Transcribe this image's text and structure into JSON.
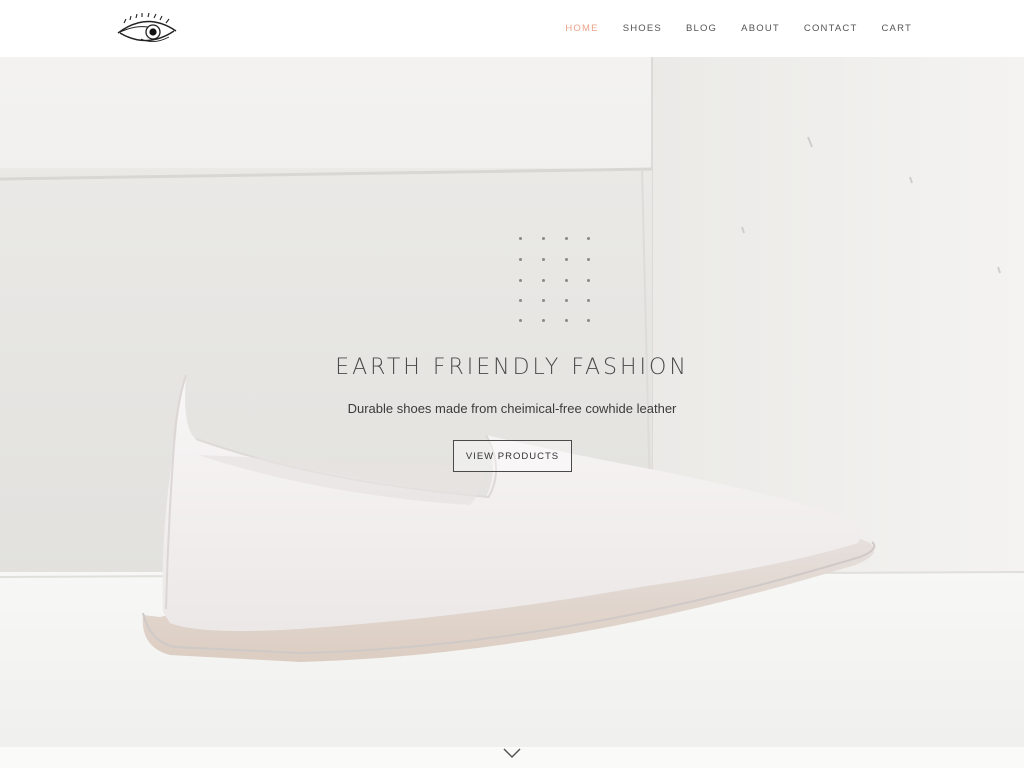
{
  "nav": {
    "items": [
      {
        "label": "HOME",
        "active": true
      },
      {
        "label": "SHOES",
        "active": false
      },
      {
        "label": "BLOG",
        "active": false
      },
      {
        "label": "ABOUT",
        "active": false
      },
      {
        "label": "CONTACT",
        "active": false
      },
      {
        "label": "CART",
        "active": false
      }
    ]
  },
  "hero": {
    "title": "EARTH FRIENDLY FASHION",
    "subtitle": "Durable shoes made from cheimical-free cowhide leather",
    "button_label": "VIEW PRODUCTS"
  },
  "icons": {
    "logo": "eye-logo-icon",
    "scroll": "chevron-down-icon"
  },
  "colors": {
    "active_nav": "#e8a48a",
    "text": "#4a4a4a",
    "background": "#f0efed"
  }
}
